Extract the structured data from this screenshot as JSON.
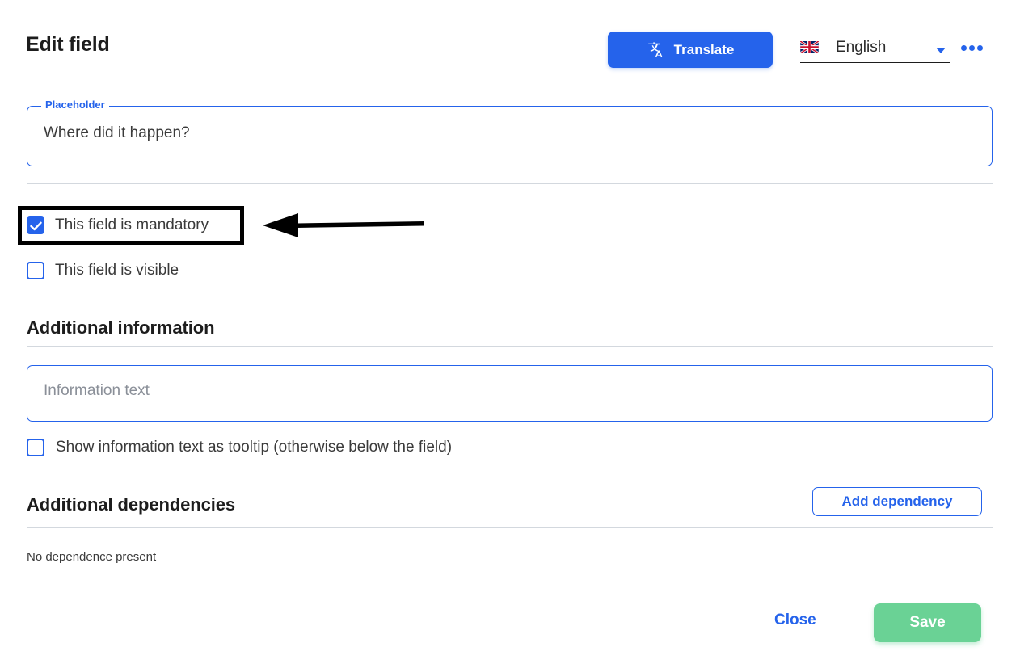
{
  "header": {
    "title": "Edit field",
    "translate_button": {
      "label": "Translate",
      "icon": "translate-icon",
      "color": "#2563eb"
    },
    "language_selector": {
      "selected": "English",
      "flag": "uk-flag-icon",
      "chevron": "chevron-down-icon"
    },
    "overflow_menu": {
      "icon": "kebab-menu-icon",
      "color": "#2563eb"
    }
  },
  "placeholder_field": {
    "legend": "Placeholder",
    "value": "Where did it happen?",
    "placeholder": ""
  },
  "options": [
    {
      "label": "This field is mandatory",
      "checked": true,
      "name": "mandatory"
    },
    {
      "label": "This field is visible",
      "checked": false,
      "name": "visible"
    }
  ],
  "additional_information": {
    "heading": "Additional information",
    "input": {
      "value": "",
      "placeholder": "Information text"
    },
    "tooltip_option": {
      "label": "Show information text as tooltip (otherwise below the field)",
      "checked": false
    }
  },
  "additional_dependencies": {
    "heading": "Additional dependencies",
    "add_button": "Add dependency",
    "empty_message": "No dependence present"
  },
  "footer": {
    "close_label": "Close",
    "save_label": "Save",
    "save_color": "#6ad295",
    "close_color": "#2563eb"
  },
  "annotation": {
    "highlight_target": "This field is mandatory",
    "arrow_color": "#000000",
    "box_color": "#000000"
  }
}
